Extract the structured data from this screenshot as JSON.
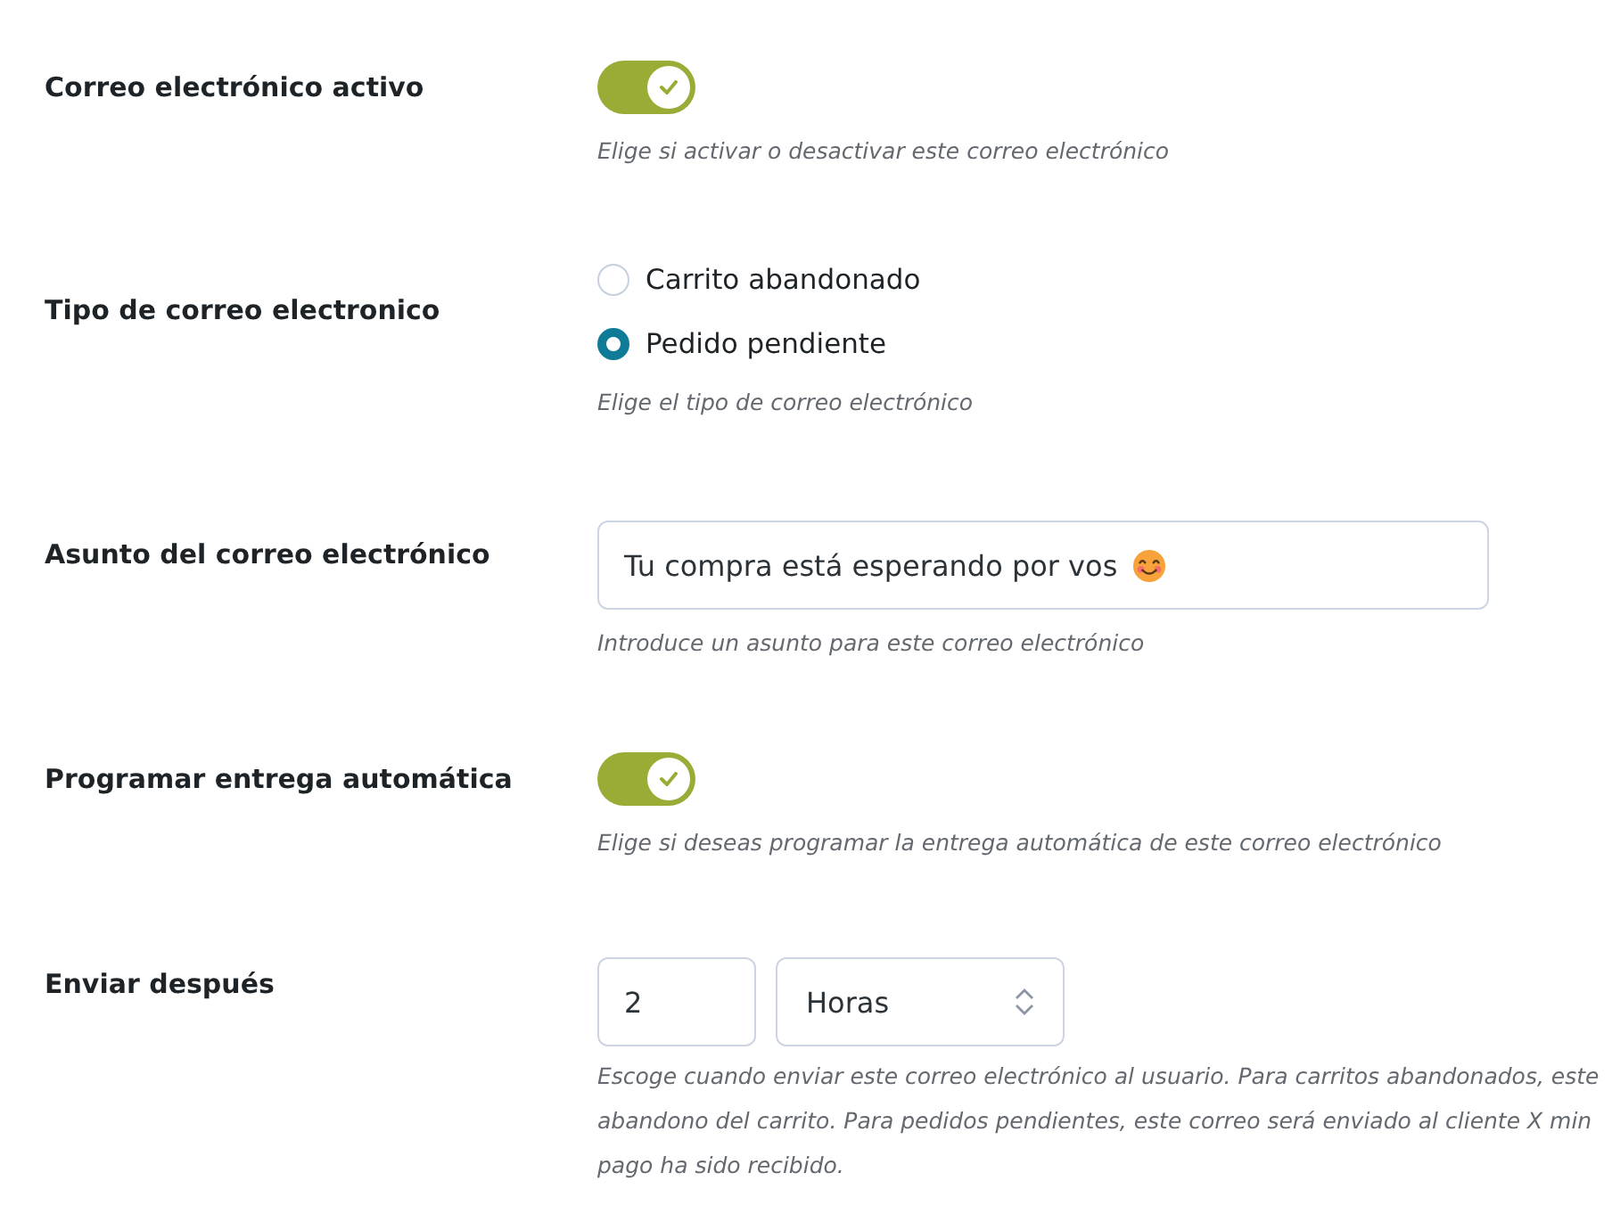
{
  "settings": [
    {
      "kind": "toggle",
      "label": "Correo electrónico activo",
      "on": true,
      "help": [
        "Elige si activar o desactivar este correo electrónico"
      ]
    },
    {
      "kind": "radio",
      "label": "Tipo de correo electronico",
      "options": [
        {
          "label": "Carrito abandonado",
          "selected": false
        },
        {
          "label": "Pedido pendiente",
          "selected": true
        }
      ],
      "help": [
        "Elige el tipo de correo electrónico"
      ]
    },
    {
      "kind": "text",
      "label": "Asunto del correo electrónico",
      "value": "Tu compra está esperando por vos",
      "help": [
        "Introduce un asunto para este correo electrónico"
      ]
    },
    {
      "kind": "toggle",
      "label": "Programar entrega automática",
      "on": true,
      "help": [
        "Elige si deseas programar la entrega automática de este correo electrónico"
      ]
    },
    {
      "kind": "delay",
      "label": "Enviar después",
      "amount": "2",
      "unit": "Horas",
      "help": [
        "Escoge cuando enviar este correo electrónico al usuario. Para carritos abandonados, este",
        "abandono del carrito. Para pedidos pendientes, este correo será enviado al cliente X min",
        "pago ha sido recibido."
      ]
    }
  ]
}
